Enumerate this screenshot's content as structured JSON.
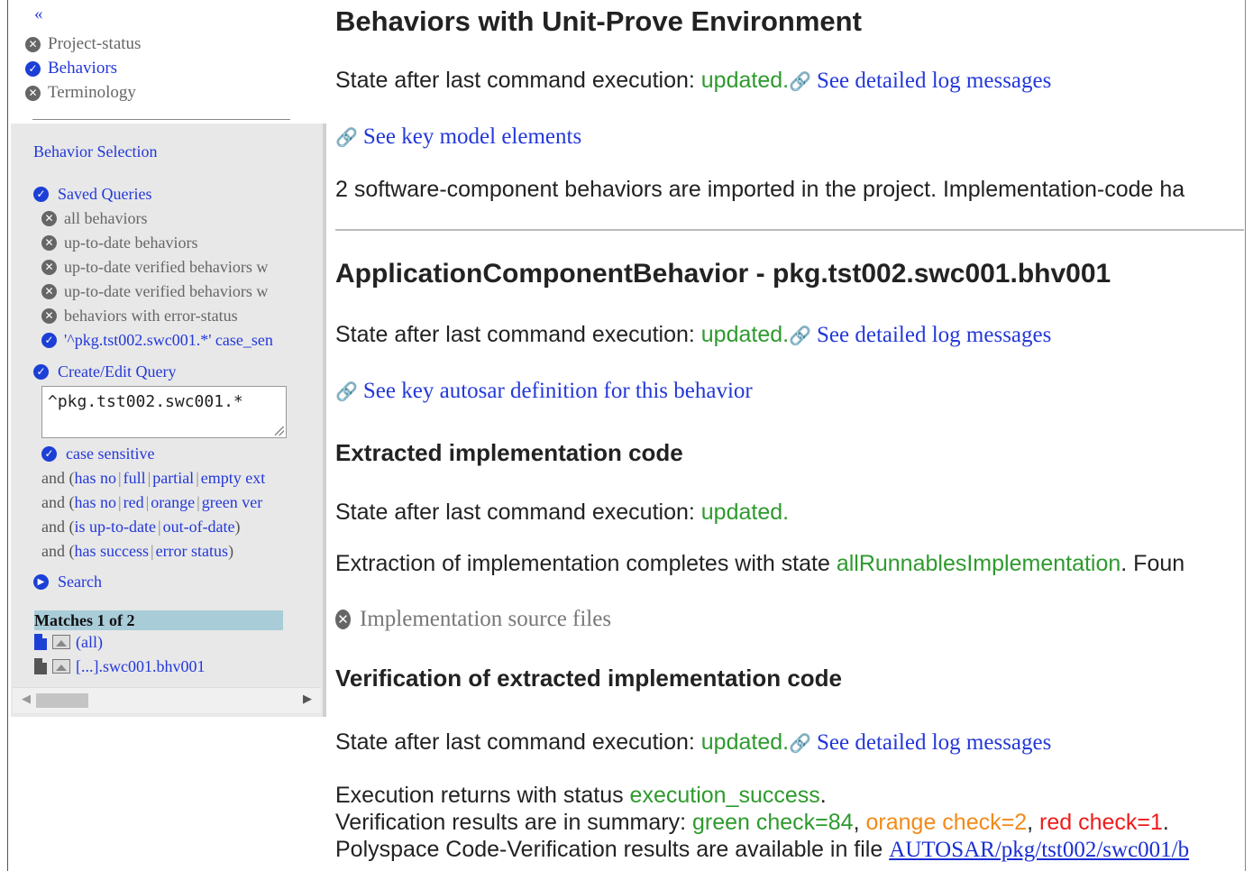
{
  "nav": {
    "collapse": "«",
    "items": [
      {
        "label": "Project-status",
        "icon": "close-circle-icon"
      },
      {
        "label": "Behaviors",
        "icon": "check-circle-icon"
      },
      {
        "label": "Terminology",
        "icon": "close-circle-icon"
      }
    ]
  },
  "panel": {
    "title": "Behavior Selection",
    "saved_queries_label": "Saved Queries",
    "saved_queries": [
      "all behaviors",
      "up-to-date behaviors",
      "up-to-date verified behaviors w",
      "up-to-date verified behaviors w",
      "behaviors with error-status",
      "'^pkg.tst002.swc001.*' case_sen"
    ],
    "create_edit_label": "Create/Edit Query",
    "query_text": "^pkg.tst002.swc001.*",
    "case_sensitive_label": "case sensitive",
    "filters": {
      "f1": {
        "prefix": "and (",
        "opts": [
          "has no",
          "full",
          "partial",
          "empty ext"
        ]
      },
      "f2": {
        "prefix": "and (",
        "opts": [
          "has no",
          "red",
          "orange",
          "green ver"
        ]
      },
      "f3": {
        "prefix": "and (",
        "opts": [
          "is up-to-date",
          "out-of-date"
        ],
        "suffix": ")"
      },
      "f4": {
        "prefix": "and (",
        "opts": [
          "has success",
          "error status"
        ],
        "suffix": ")"
      }
    },
    "search_label": "Search",
    "matches_label": "Matches 1 of 2",
    "match_items": [
      "(all)",
      "[...].swc001.bhv001"
    ]
  },
  "main": {
    "title": "Behaviors with Unit-Prove Environment",
    "state_prefix": "State after last command execution: ",
    "state_value": "updated",
    "period": ".",
    "log_link": "See detailed log messages",
    "key_model_link": "See key model elements",
    "import_summary": "2 software-component behaviors are imported in the project. Implementation-code ha",
    "behavior_title": "ApplicationComponentBehavior - pkg.tst002.swc001.bhv001",
    "autosar_link": "See key autosar definition for this behavior",
    "extracted_title": "Extracted implementation code",
    "extraction_prefix": "Extraction of implementation completes with state ",
    "extraction_state": "allRunnablesImplementation",
    "extraction_suffix": ". Foun",
    "impl_sources": "Implementation source files",
    "verification_title": "Verification of extracted implementation code",
    "exec_prefix": "Execution returns with status ",
    "exec_status": "execution_success",
    "results_prefix": "Verification results are in summary: ",
    "green_check": "green check=84",
    "orange_check": "orange check=2",
    "red_check": "red check=1",
    "comma": ", ",
    "polyspace_prefix": "Polyspace Code-Verification results are available in file ",
    "polyspace_file": "AUTOSAR/pkg/tst002/swc001/b"
  },
  "colors": {
    "link_blue": "#2338d8",
    "status_green": "#2e9a2e",
    "status_orange": "#f28a18",
    "status_red": "#ee1c1c",
    "matches_bg": "#a9ccd9"
  }
}
